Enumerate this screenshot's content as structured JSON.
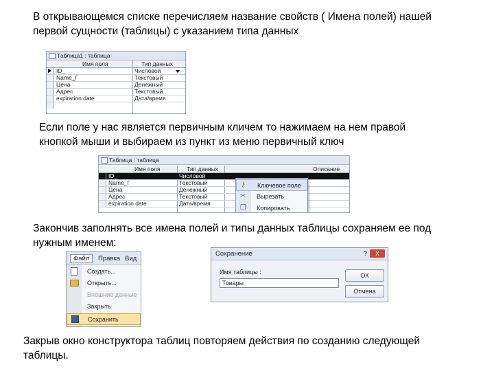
{
  "text": {
    "p1": [
      "В открывающемся списке перечисляем название свойств ( Имена полей) нашей",
      "первой сущности (таблицы) с указанием типа данных"
    ],
    "p2": [
      "Если поле у нас является первичным кличем то нажимаем на нем правой",
      "кнопкой мыши и выбираем из пункт из меню первичный ключ"
    ],
    "p3": [
      "Закончив заполнять все имена полей и типы данных таблицы сохраняем ее под",
      "нужным именем:"
    ],
    "p4": [
      "Закрыв окно конструктора таблиц повторяем действия по созданию следующей",
      "таблицы."
    ]
  },
  "shot1": {
    "title": "Таблица1 : таблица",
    "col_name": "Имя поля",
    "col_type": "Тип данных",
    "rows": [
      {
        "name": "ID_",
        "type": "Числовой"
      },
      {
        "name": "Name_Г",
        "type": "Текстовый"
      },
      {
        "name": "Цена",
        "type": "Денежный"
      },
      {
        "name": "Адрес",
        "type": "Текстовый"
      },
      {
        "name": "expiration date",
        "type": "Дата/время"
      }
    ]
  },
  "shot2": {
    "title": "Таблица : таблица",
    "col_name": "Имя поля",
    "col_type": "Тип данных",
    "col_desc": "Описание",
    "rows": [
      {
        "name": "ID_",
        "type": "Числовой"
      },
      {
        "name": "Name_Г",
        "type": "Текстовый"
      },
      {
        "name": "Цена",
        "type": "Денежный"
      },
      {
        "name": "Адрес",
        "type": "Текстовый"
      },
      {
        "name": "expiration date",
        "type": "Дата/время"
      }
    ],
    "menu": [
      "Ключевое поле",
      "Вырезать",
      "Копировать"
    ]
  },
  "shot3": {
    "menubar": [
      "Файл",
      "Правка",
      "Вид"
    ],
    "items": [
      "Создать...",
      "Открыть...",
      "Внешние данные",
      "Закрыть",
      "Сохранить"
    ]
  },
  "shot4": {
    "title": "Сохранение",
    "label": "Имя таблицы :",
    "value": "Товары",
    "ok": "ОК",
    "cancel": "Отмена",
    "help": "?",
    "close": "X"
  }
}
